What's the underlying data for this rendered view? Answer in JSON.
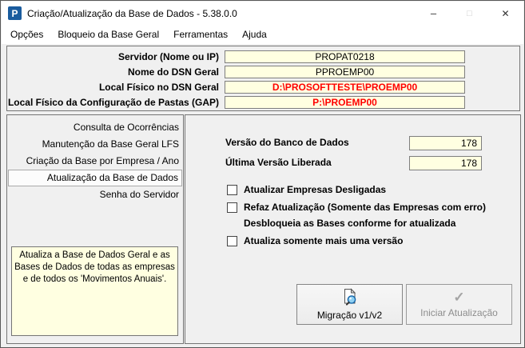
{
  "window": {
    "title": "Criação/Atualização da Base de Dados - 5.38.0.0",
    "app_icon_letter": "P",
    "controls": {
      "minimize": "–",
      "maximize": "□",
      "close": "✕"
    }
  },
  "menu": {
    "items": [
      {
        "label": "Opções"
      },
      {
        "label": "Bloqueio da Base Geral"
      },
      {
        "label": "Ferramentas"
      },
      {
        "label": "Ajuda"
      }
    ]
  },
  "server_form": {
    "fields": [
      {
        "label": "Servidor (Nome ou IP)",
        "value": "PROPAT0218",
        "value_color": "#000000"
      },
      {
        "label": "Nome do DSN Geral",
        "value": "PPROEMP00",
        "value_color": "#000000"
      },
      {
        "label": "Local Físico no DSN Geral",
        "value": "D:\\PROSOFTTESTE\\PROEMP00",
        "value_color": "#ff0000"
      },
      {
        "label": "Local Físico da Configuração de Pastas (GAP)",
        "value": "P:\\PROEMP00",
        "value_color": "#ff0000"
      }
    ]
  },
  "sidebar": {
    "items": [
      {
        "label": "Consulta de Ocorrências",
        "selected": false
      },
      {
        "label": "Manutenção da Base Geral LFS",
        "selected": false
      },
      {
        "label": "Criação da Base por Empresa / Ano",
        "selected": false
      },
      {
        "label": "Atualização da Base de Dados",
        "selected": true
      },
      {
        "label": "Senha do Servidor",
        "selected": false
      }
    ],
    "description": "Atualiza a Base de Dados Geral e as Bases de Dados de todas as empresas e de todos os 'Movimentos Anuais'."
  },
  "main": {
    "version_fields": [
      {
        "label": "Versão do Banco de Dados",
        "value": "178"
      },
      {
        "label": "Última Versão Liberada",
        "value": "178"
      }
    ],
    "checkboxes": [
      {
        "label": "Atualizar Empresas Desligadas",
        "checked": false
      },
      {
        "label": "Refaz Atualização (Somente das Empresas com erro)",
        "checked": false,
        "note": "Desbloqueia as Bases conforme for atualizada"
      },
      {
        "label": "Atualiza somente mais uma versão",
        "checked": false
      }
    ],
    "buttons": [
      {
        "label": "Migração v1/v2",
        "enabled": true,
        "icon": "document-search-icon"
      },
      {
        "label": "Iniciar Atualização",
        "enabled": false,
        "icon": "checkmark-icon",
        "icon_glyph": "✓"
      }
    ]
  },
  "colors": {
    "field_yellow": "#ffffe1",
    "alert_red": "#ff0000",
    "app_icon_blue": "#1a5c9e",
    "disabled_gray": "#8d8d8d",
    "panel_border": "#757575"
  }
}
